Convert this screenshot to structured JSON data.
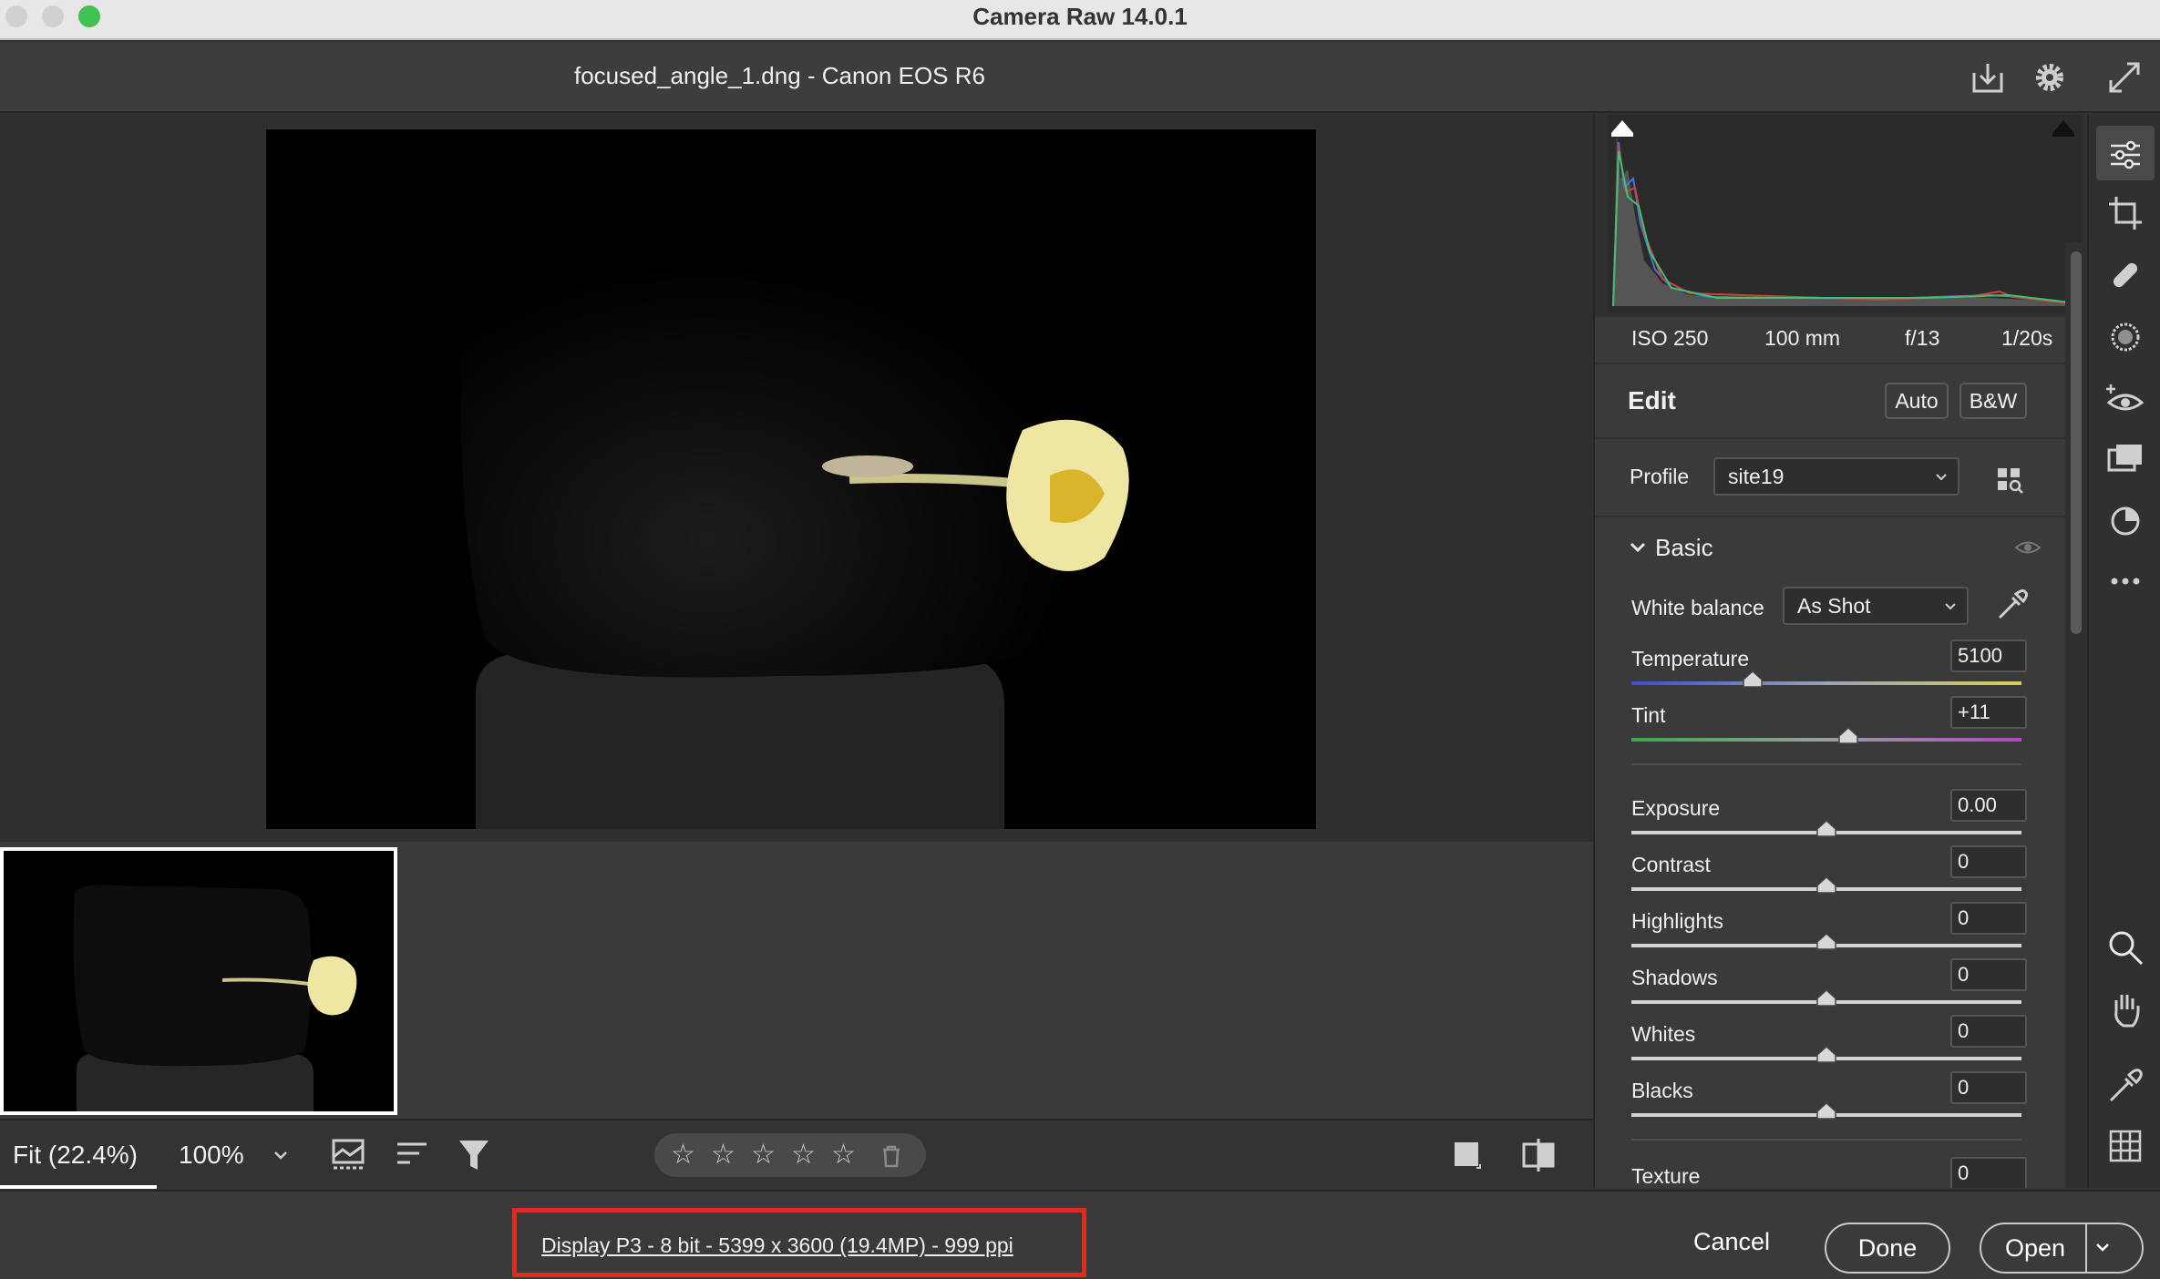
{
  "window": {
    "title": "Camera Raw 14.0.1"
  },
  "header": {
    "file_title": "focused_angle_1.dng  -  Canon EOS R6",
    "icons": [
      "save-download-icon",
      "gear-icon",
      "fullscreen-icon"
    ]
  },
  "bottom": {
    "zoom_fit": "Fit (22.4%)",
    "zoom_100": "100%",
    "rating_stars": 5
  },
  "footer": {
    "workflow_info": "Display P3 - 8 bit - 5399 x 3600 (19.4MP) - 999 ppi",
    "cancel": "Cancel",
    "done": "Done",
    "open": "Open"
  },
  "exif": {
    "iso": "ISO 250",
    "focal": "100 mm",
    "aperture": "f/13",
    "shutter": "1/20s"
  },
  "edit": {
    "title": "Edit",
    "auto": "Auto",
    "bw": "B&W",
    "profile_label": "Profile",
    "profile_value": "site19"
  },
  "basic": {
    "title": "Basic",
    "wb_label": "White balance",
    "wb_value": "As Shot",
    "sliders": [
      {
        "label": "Temperature",
        "value": "5100",
        "pos": 0.31
      },
      {
        "label": "Tint",
        "value": "+11",
        "pos": 0.555
      },
      {
        "label": "Exposure",
        "value": "0.00",
        "pos": 0.5
      },
      {
        "label": "Contrast",
        "value": "0",
        "pos": 0.5
      },
      {
        "label": "Highlights",
        "value": "0",
        "pos": 0.5
      },
      {
        "label": "Shadows",
        "value": "0",
        "pos": 0.5
      },
      {
        "label": "Whites",
        "value": "0",
        "pos": 0.5
      },
      {
        "label": "Blacks",
        "value": "0",
        "pos": 0.5
      },
      {
        "label": "Texture",
        "value": "0",
        "pos": 0.5
      }
    ]
  },
  "colors": {
    "accent_red": "#e02a1e",
    "window_green": "#3fc24f"
  }
}
